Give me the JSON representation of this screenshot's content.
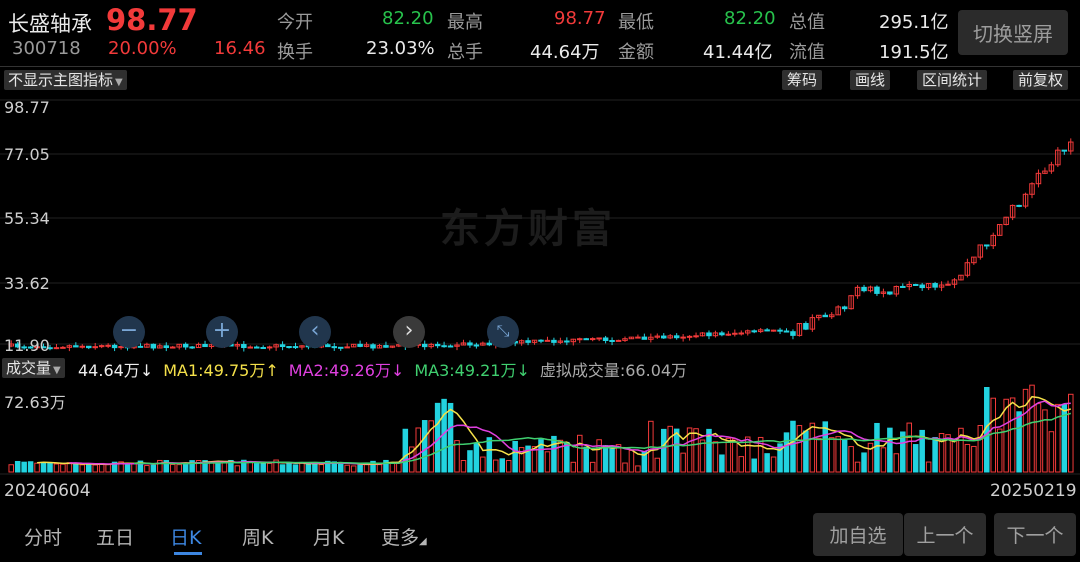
{
  "header": {
    "stock_name": "长盛轴承",
    "price": "98.77",
    "code": "300718",
    "change_pct": "20.00%",
    "change_amt": "16.46",
    "stats": [
      {
        "label": "今开",
        "value": "82.20",
        "color": "green"
      },
      {
        "label": "最高",
        "value": "98.77",
        "color": "red"
      },
      {
        "label": "最低",
        "value": "82.20",
        "color": "green"
      },
      {
        "label": "总值",
        "value": "295.1亿",
        "color": "white"
      },
      {
        "label": "换手",
        "value": "23.03%",
        "color": "white"
      },
      {
        "label": "总手",
        "value": "44.64万",
        "color": "white"
      },
      {
        "label": "金额",
        "value": "41.44亿",
        "color": "white"
      },
      {
        "label": "流值",
        "value": "191.5亿",
        "color": "white"
      }
    ],
    "portrait_button": "切换竖屏"
  },
  "toolbar": {
    "indicator_select": "不显示主图指标",
    "chip_button": "筹码",
    "draw_button": "画线",
    "range_stats_button": "区间统计",
    "adjust_button": "前复权"
  },
  "main_chart": {
    "y_ticks": [
      "98.77",
      "77.05",
      "55.34",
      "33.62",
      "11.90"
    ],
    "watermark": "东方财富",
    "controls": [
      "−",
      "+",
      "‹",
      "›"
    ]
  },
  "volume": {
    "indicator_select": "成交量",
    "value": "44.64万",
    "value_arrow": "↓",
    "ma1": "MA1:49.75万",
    "ma1_arrow": "↑",
    "ma2": "MA2:49.26万",
    "ma2_arrow": "↓",
    "ma3": "MA3:49.21万",
    "ma3_arrow": "↓",
    "virtual": "虚拟成交量:66.04万",
    "max_label": "72.63万"
  },
  "dates": {
    "start": "20240604",
    "end": "20250219"
  },
  "tabs": [
    {
      "label": "分时",
      "active": false
    },
    {
      "label": "五日",
      "active": false
    },
    {
      "label": "日K",
      "active": true
    },
    {
      "label": "周K",
      "active": false
    },
    {
      "label": "月K",
      "active": false
    },
    {
      "label": "更多",
      "active": false
    }
  ],
  "nav": {
    "add_watchlist": "加自选",
    "prev": "上一个",
    "next": "下一个"
  },
  "colors": {
    "up": "#f23a3a",
    "down": "#22d3e0",
    "ma1": "#f5e14a",
    "ma2": "#e040e0",
    "ma3": "#40d070",
    "accent": "#3d86e0"
  }
}
